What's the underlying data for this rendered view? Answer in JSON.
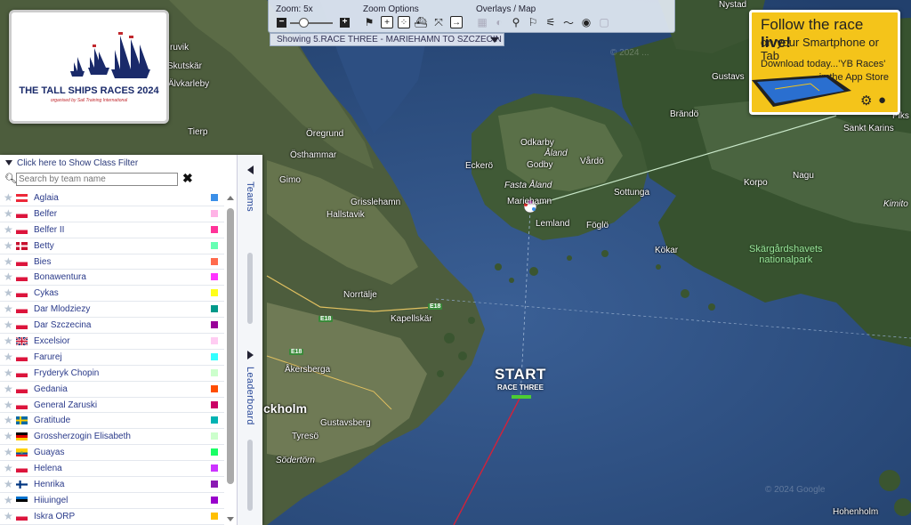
{
  "app": {
    "logo_title": "THE TALL SHIPS RACES 2024",
    "logo_subtitle": "organised by Sail Training International"
  },
  "toolbar": {
    "zoom_label": "Zoom: 5x",
    "zoom_minus": "−",
    "zoom_plus": "+",
    "zoom_options_label": "Zoom Options",
    "overlays_label": "Overlays / Map",
    "race_selector": "Showing 5.RACE THREE - MARIEHAMN TO SZCZECIN"
  },
  "ad": {
    "line1_prefix": "Follow the race ",
    "line1_bold": "live!",
    "line2": "on your Smartphone or Tab",
    "line3": "Download today...'YB Races'",
    "line4": "in the App Store"
  },
  "map": {
    "start_label": "START",
    "start_sub": "RACE THREE",
    "watermark1": "© 2024 ...",
    "watermark2": "© 2024 Google",
    "places": [
      {
        "text": "Nystad",
        "it": false
      },
      {
        "text": "ruvik",
        "it": false
      },
      {
        "text": "Skutskär",
        "it": false
      },
      {
        "text": "Älvkarleby",
        "it": false
      },
      {
        "text": "Gustavs",
        "it": false
      },
      {
        "text": "Brändö",
        "it": false
      },
      {
        "text": "Piks",
        "it": false
      },
      {
        "text": "Sankt Karins",
        "it": false
      },
      {
        "text": "Öregrund",
        "it": false
      },
      {
        "text": "Östhammar",
        "it": false
      },
      {
        "text": "Tierp",
        "it": false
      },
      {
        "text": "Odkarby",
        "it": false
      },
      {
        "text": "Åland",
        "it": true
      },
      {
        "text": "Godby",
        "it": false
      },
      {
        "text": "Vårdö",
        "it": false
      },
      {
        "text": "Eckerö",
        "it": false
      },
      {
        "text": "Fasta Åland",
        "it": true
      },
      {
        "text": "Sottunga",
        "it": false
      },
      {
        "text": "Korpo",
        "it": false
      },
      {
        "text": "Nagu",
        "it": false
      },
      {
        "text": "Kimito",
        "it": true
      },
      {
        "text": "Gimo",
        "it": false
      },
      {
        "text": "Grisslehamn",
        "it": false
      },
      {
        "text": "Hallstavik",
        "it": false
      },
      {
        "text": "Mariehamn",
        "it": false
      },
      {
        "text": "Lemland",
        "it": false
      },
      {
        "text": "Föglö",
        "it": false
      },
      {
        "text": "Kökar",
        "it": false
      },
      {
        "text": "Norrtälje",
        "it": false
      },
      {
        "text": "Kapellskär",
        "it": false
      },
      {
        "text": "Åkersberga",
        "it": false
      },
      {
        "text": "Gustavsberg",
        "it": false
      },
      {
        "text": "Tyresö",
        "it": false
      },
      {
        "text": "Södertörn",
        "it": true
      },
      {
        "text": "Hohenholm",
        "it": false
      }
    ],
    "stockholm": "ckholm",
    "park": "Skärgårdshavets\nnationalpark",
    "roads": [
      "E18",
      "E18",
      "E18"
    ]
  },
  "panel": {
    "class_filter": "Click here to Show Class Filter",
    "search_placeholder": "Search by team name",
    "tab_teams": "Teams",
    "tab_leaderboard": "Leaderboard",
    "teams": [
      {
        "name": "Aglaia",
        "flag": "at",
        "color": "#3b8fe8"
      },
      {
        "name": "Belfer",
        "flag": "pl",
        "color": "#ffb3e6"
      },
      {
        "name": "Belfer II",
        "flag": "pl",
        "color": "#ff3399"
      },
      {
        "name": "Betty",
        "flag": "dk",
        "color": "#66ffb3"
      },
      {
        "name": "Bies",
        "flag": "pl",
        "color": "#ff6b4d"
      },
      {
        "name": "Bonawentura",
        "flag": "pl",
        "color": "#ff33ff"
      },
      {
        "name": "Cykas",
        "flag": "pl",
        "color": "#ffff1a"
      },
      {
        "name": "Dar Mlodziezy",
        "flag": "pl",
        "color": "#00998a"
      },
      {
        "name": "Dar Szczecina",
        "flag": "pl",
        "color": "#990099"
      },
      {
        "name": "Excelsior",
        "flag": "gb",
        "color": "#ffccf2"
      },
      {
        "name": "Farurej",
        "flag": "pl",
        "color": "#33ffff"
      },
      {
        "name": "Fryderyk Chopin",
        "flag": "pl",
        "color": "#ccffcc"
      },
      {
        "name": "Gedania",
        "flag": "pl",
        "color": "#ff4d00"
      },
      {
        "name": "General Zaruski",
        "flag": "pl",
        "color": "#cc0066"
      },
      {
        "name": "Gratitude",
        "flag": "se",
        "color": "#00b3b3"
      },
      {
        "name": "Grossherzogin Elisabeth",
        "flag": "de",
        "color": "#ccffcc"
      },
      {
        "name": "Guayas",
        "flag": "ec",
        "color": "#1aff66"
      },
      {
        "name": "Helena",
        "flag": "pl",
        "color": "#cc33ff"
      },
      {
        "name": "Henrika",
        "flag": "fi",
        "color": "#8a1ab3"
      },
      {
        "name": "Hiiuingel",
        "flag": "ee",
        "color": "#9900cc"
      },
      {
        "name": "Iskra ORP",
        "flag": "pl",
        "color": "#ffbf00"
      }
    ]
  }
}
